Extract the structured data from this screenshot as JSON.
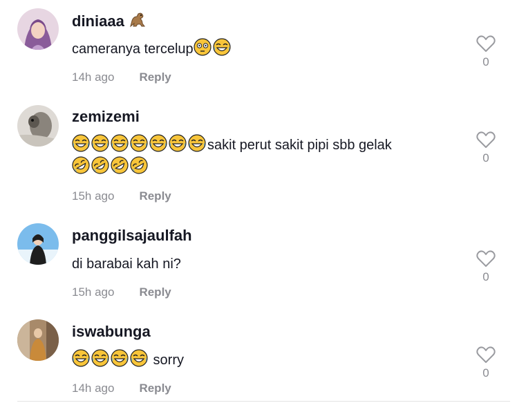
{
  "comments": [
    {
      "username": "diniaaa",
      "username_emoji": "dinosaur",
      "text_a": "cameranya tercelup",
      "emojis_after": [
        "flushed",
        "joy"
      ],
      "time": "14h ago",
      "reply": "Reply",
      "likes": "0",
      "avatar_colors": [
        "#c9a8c9",
        "#7a5a8a",
        "#f1d2c2"
      ]
    },
    {
      "username": "zemizemi",
      "emojis_before": [
        "joy",
        "joy",
        "joy",
        "joy",
        "joy",
        "joy",
        "joy"
      ],
      "text_a": "sakit perut sakit pipi sbb gelak",
      "emojis_line2": [
        "rofl",
        "rofl",
        "rofl",
        "rofl"
      ],
      "time": "15h ago",
      "reply": "Reply",
      "likes": "0",
      "avatar_colors": [
        "#d9d5cf",
        "#6b6660",
        "#f0eee8"
      ]
    },
    {
      "username": "panggilsajaulfah",
      "text_a": "di barabai kah ni?",
      "time": "15h ago",
      "reply": "Reply",
      "likes": "0",
      "avatar_colors": [
        "#6fb3e6",
        "#2a2a2a",
        "#e6f2fa"
      ]
    },
    {
      "username": "iswabunga",
      "emojis_before": [
        "joy",
        "joy",
        "joy",
        "joy"
      ],
      "text_a": " sorry",
      "time": "14h ago",
      "reply": "Reply",
      "likes": "0",
      "avatar_colors": [
        "#b59a7a",
        "#7a5a3a",
        "#e8d6c0"
      ]
    }
  ],
  "colors": {
    "text": "#161823",
    "muted": "#8a8b91",
    "heart": "#9a9ba0",
    "emoji": "#f8c53a"
  }
}
